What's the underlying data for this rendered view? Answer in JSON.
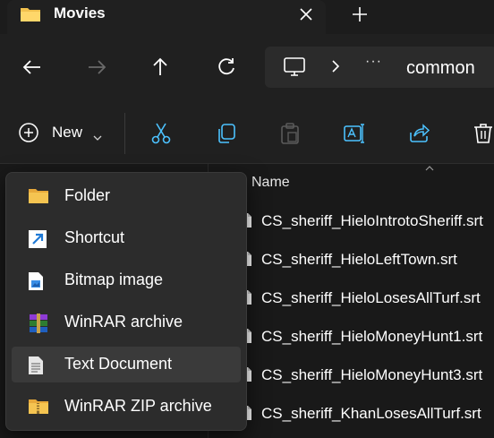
{
  "tab": {
    "title": "Movies",
    "folder_icon": "folder-icon",
    "close_icon": "close-icon",
    "new_tab_icon": "plus-icon"
  },
  "nav": {
    "back_icon": "arrow-left-icon",
    "forward_icon": "arrow-right-icon",
    "up_icon": "arrow-up-icon",
    "refresh_icon": "refresh-icon"
  },
  "address": {
    "pc_icon": "this-pc-icon",
    "ellipsis": "···",
    "crumb": "common"
  },
  "toolbar": {
    "new_label": "New",
    "tools": [
      "cut-icon",
      "copy-icon",
      "paste-icon",
      "rename-icon",
      "share-icon",
      "delete-icon"
    ]
  },
  "file_list": {
    "column_header": "Name",
    "files": [
      "CS_sheriff_HieloIntrotoSheriff.srt",
      "CS_sheriff_HieloLeftTown.srt",
      "CS_sheriff_HieloLosesAllTurf.srt",
      "CS_sheriff_HieloMoneyHunt1.srt",
      "CS_sheriff_HieloMoneyHunt3.srt",
      "CS_sheriff_KhanLosesAllTurf.srt"
    ]
  },
  "new_menu": {
    "items": [
      {
        "label": "Folder",
        "icon": "folder-icon"
      },
      {
        "label": "Shortcut",
        "icon": "shortcut-icon"
      },
      {
        "label": "Bitmap image",
        "icon": "bitmap-image-icon"
      },
      {
        "label": "WinRAR archive",
        "icon": "winrar-archive-icon"
      },
      {
        "label": "Text Document",
        "icon": "text-document-icon"
      },
      {
        "label": "WinRAR ZIP archive",
        "icon": "winrar-zip-icon"
      }
    ],
    "highlighted_index": 4
  },
  "colors": {
    "accent": "#4cc2ff",
    "folder": "#f2c14e",
    "menu_bg": "#2c2c2c",
    "highlight": "#3a3a3a"
  }
}
